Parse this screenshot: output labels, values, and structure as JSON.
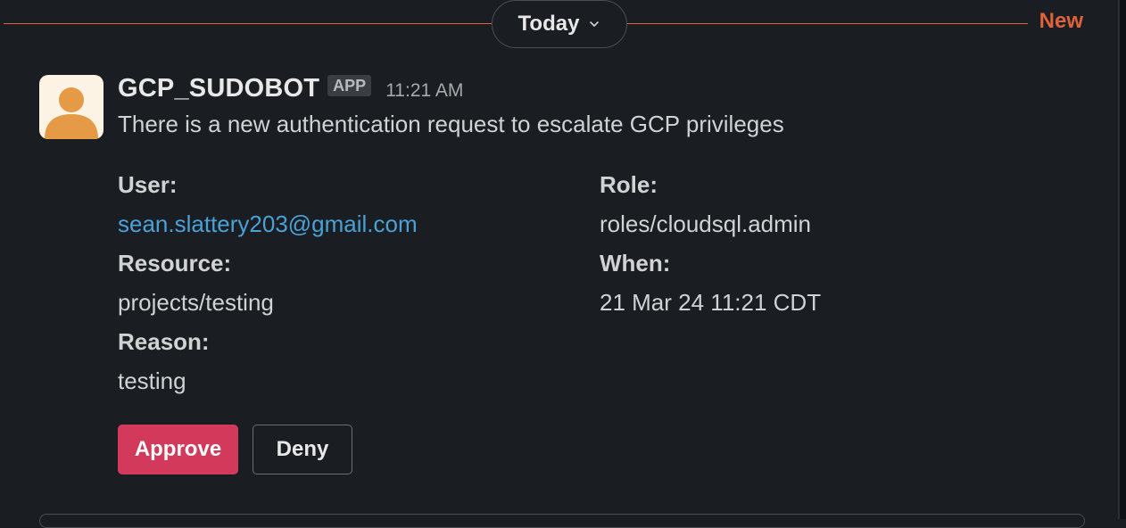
{
  "divider": {
    "date_label": "Today",
    "new_label": "New"
  },
  "message": {
    "sender": "GCP_SUDOBOT",
    "badge": "APP",
    "time": "11:21 AM",
    "text": "There is a new authentication request to escalate GCP privileges"
  },
  "fields": {
    "user_label": "User:",
    "user_value": "sean.slattery203@gmail.com",
    "resource_label": "Resource:",
    "resource_value": "projects/testing",
    "reason_label": "Reason:",
    "reason_value": "testing",
    "role_label": "Role:",
    "role_value": "roles/cloudsql.admin",
    "when_label": "When:",
    "when_value": "21 Mar 24 11:21 CDT"
  },
  "actions": {
    "approve_label": "Approve",
    "deny_label": "Deny"
  },
  "colors": {
    "background": "#1a1d21",
    "accent_new": "#e0623b",
    "approve": "#d2395b",
    "link": "#4aa1d8",
    "avatar_bg": "#fdf3e4",
    "avatar_fg": "#e59a45"
  },
  "icons": {
    "avatar": "user-avatar-icon",
    "date_toggle": "chevron-down-icon"
  }
}
